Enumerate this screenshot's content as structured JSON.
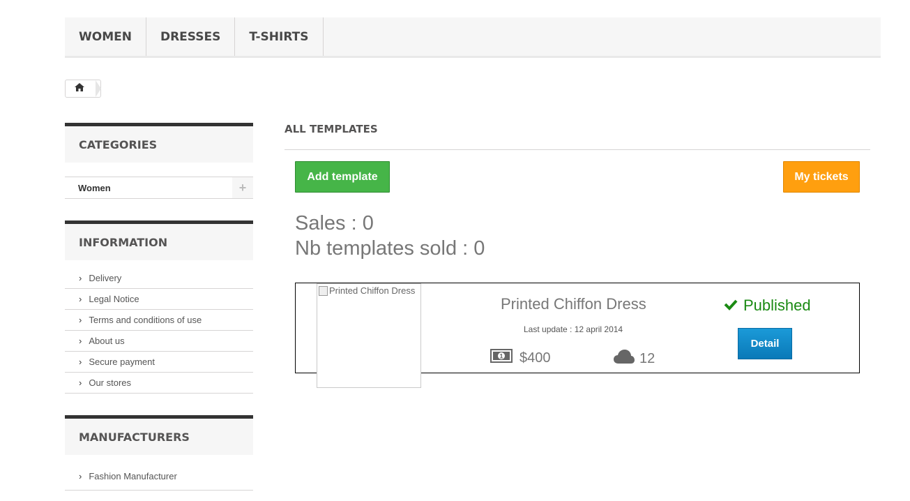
{
  "topmenu": {
    "items": [
      {
        "label": "WOMEN"
      },
      {
        "label": "DRESSES"
      },
      {
        "label": "T-SHIRTS"
      }
    ]
  },
  "breadcrumb": {
    "home_icon": "home-icon"
  },
  "sidebar": {
    "categories": {
      "title": "CATEGORIES",
      "items": [
        {
          "label": "Women",
          "expand": "+"
        }
      ]
    },
    "information": {
      "title": "INFORMATION",
      "items": [
        {
          "label": "Delivery"
        },
        {
          "label": "Legal Notice"
        },
        {
          "label": "Terms and conditions of use"
        },
        {
          "label": "About us"
        },
        {
          "label": "Secure payment"
        },
        {
          "label": "Our stores"
        }
      ]
    },
    "manufacturers": {
      "title": "MANUFACTURERS",
      "items": [
        {
          "label": "Fashion Manufacturer"
        }
      ]
    },
    "chevron": "›"
  },
  "main": {
    "title": "ALL TEMPLATES",
    "add_template_label": "Add template",
    "my_tickets_label": "My tickets",
    "sales_text": "Sales : 0",
    "sold_text": "Nb templates sold : 0",
    "template": {
      "image_alt": "Printed Chiffon Dress",
      "name": "Printed Chiffon Dress",
      "last_update": "Last update : 12 april 2014",
      "price": "$400",
      "downloads": "12",
      "status": "Published",
      "detail_label": "Detail"
    }
  },
  "colors": {
    "add_button": "#46b548",
    "tickets_button": "#ff9f0f",
    "detail_button": "#1b9ad8",
    "published": "#1a8a13"
  }
}
